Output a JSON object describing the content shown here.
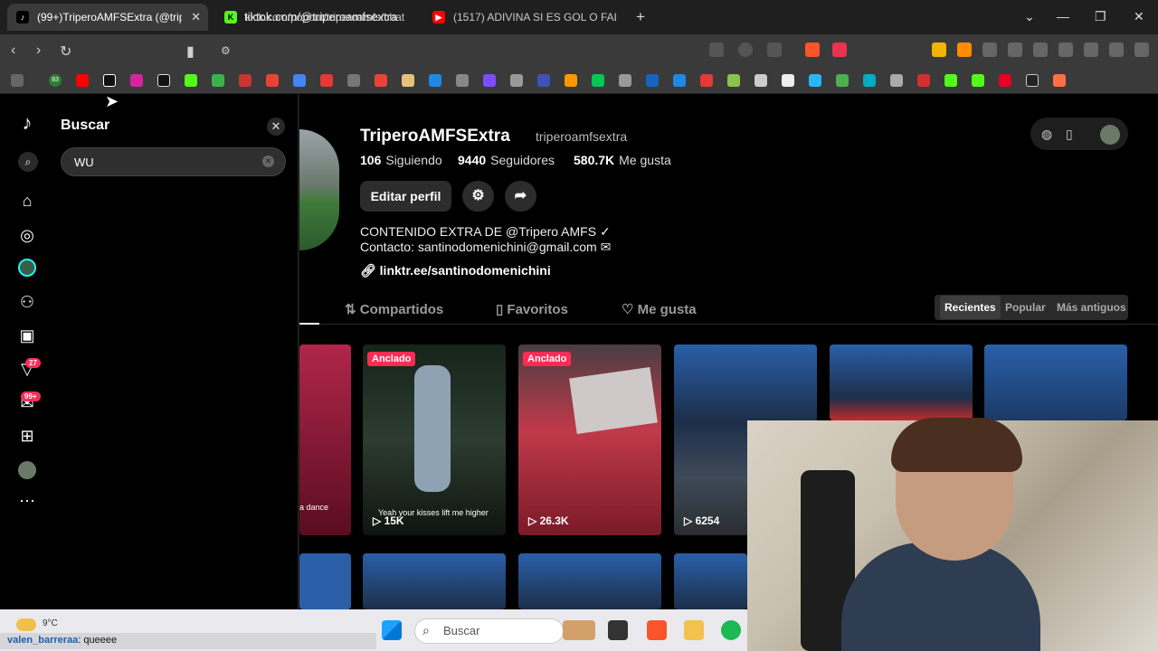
{
  "browser": {
    "tabs": [
      {
        "title": "(99+)TriperoAMFSExtra (@triper",
        "active": true
      },
      {
        "title": "kick.com/popout/triperoamfs/chat",
        "active": false
      },
      {
        "title": "(1517) ADIVINA SI ES GOL O FALLO /",
        "active": false
      }
    ],
    "new_tab": "+",
    "url": "tiktok.com/@triperoamfsextra",
    "bookmark_badge": "83"
  },
  "tiktok": {
    "search": {
      "title": "Buscar",
      "value": "WU",
      "close": "✕",
      "clear": "✕"
    },
    "rail_badges": {
      "friends": "27",
      "inbox": "99+"
    },
    "profile": {
      "name": "TriperoAMFSExtra",
      "handle": "triperoamfsextra",
      "following_count": "106",
      "following_label": "Siguiendo",
      "followers_count": "9440",
      "followers_label": "Seguidores",
      "likes_count": "580.7K",
      "likes_label": "Me gusta",
      "edit_button": "Editar perfil",
      "bio_line1": "CONTENIDO EXTRA DE @Tripero AMFS ✓",
      "bio_line2": "Contacto: santinodomenichini@gmail.com ✉",
      "link": "linktr.ee/santinodomenichini"
    },
    "tabs": [
      "Compartidos",
      "Favoritos",
      "Me gusta"
    ],
    "sort": [
      "Recientes",
      "Popular",
      "Más antiguos"
    ],
    "videos": [
      {
        "caption": "a dance",
        "pinned": "",
        "views": ""
      },
      {
        "caption": "Yeah your kisses lift me higher",
        "pinned": "Anclado",
        "views": "15K"
      },
      {
        "caption": "",
        "pinned": "Anclado",
        "views": "26.3K"
      },
      {
        "caption": "",
        "pinned": "",
        "views": "6254"
      }
    ]
  },
  "taskbar": {
    "weather": "9°C",
    "search_placeholder": "Buscar",
    "chat_user": "valen_barreraa",
    "chat_message": ": queeee"
  },
  "colors": {
    "accent": "#fe2c55",
    "bg": "#000000",
    "chrome": "#3a3a3a"
  }
}
